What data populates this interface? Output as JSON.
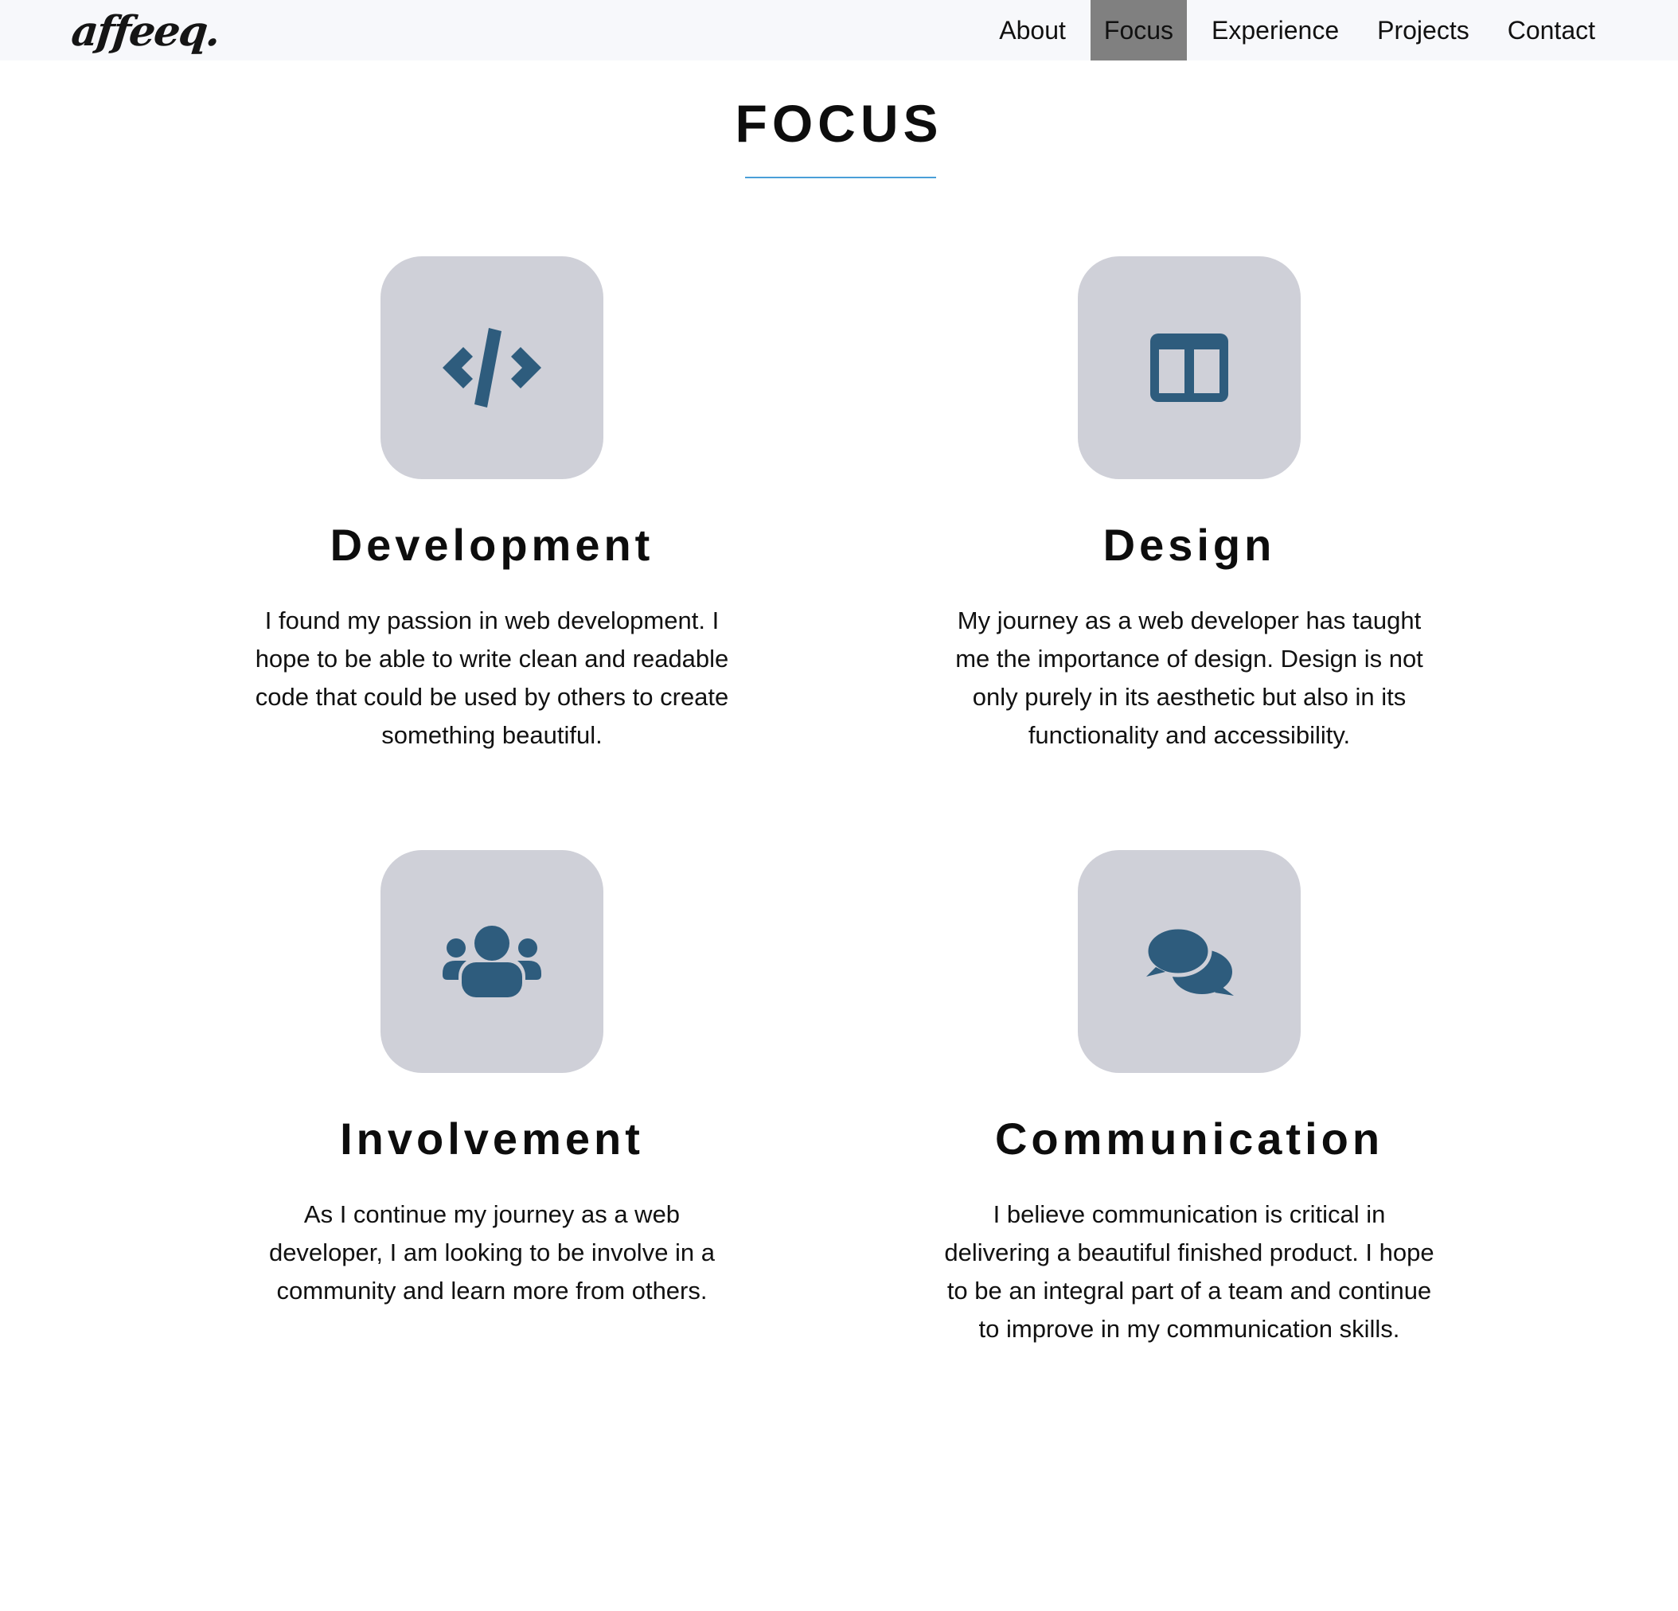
{
  "navbar": {
    "logo": "affeeq.",
    "links": [
      {
        "label": "About",
        "active": false
      },
      {
        "label": "Focus",
        "active": true
      },
      {
        "label": "Experience",
        "active": false
      },
      {
        "label": "Projects",
        "active": false
      },
      {
        "label": "Contact",
        "active": false
      }
    ]
  },
  "section": {
    "title": "FOCUS"
  },
  "colors": {
    "icon": "#2e5c7d",
    "icon_box": "#cfd0d8",
    "underline": "#4a9fd8",
    "active_nav": "#808080"
  },
  "cards": [
    {
      "icon": "code-icon",
      "title": "Development",
      "text": "I found my passion in web development. I hope to be able to write clean and readable code that could be used by others to create something beautiful."
    },
    {
      "icon": "columns-layout-icon",
      "title": "Design",
      "text": "My journey as a web developer has taught me the importance of design. Design is not only purely in its aesthetic but also in its functionality and accessibility."
    },
    {
      "icon": "users-icon",
      "title": "Involvement",
      "text": "As I continue my journey as a web developer, I am looking to be involve in a community and learn more from others."
    },
    {
      "icon": "comments-icon",
      "title": "Communication",
      "text": "I believe communication is critical in delivering a beautiful finished product. I hope to be an integral part of a team and continue to improve in my communication skills."
    }
  ]
}
